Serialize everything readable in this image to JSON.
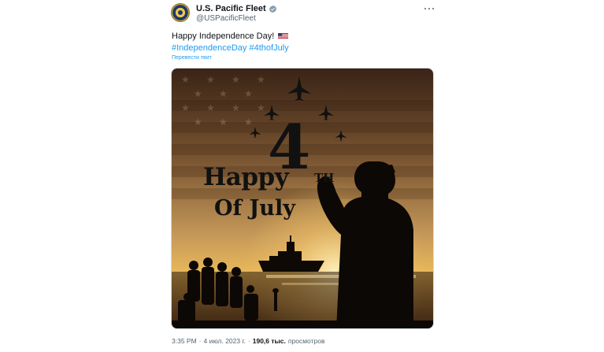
{
  "account": {
    "display_name": "U.S. Pacific Fleet",
    "handle": "@USPacificFleet",
    "verified": true
  },
  "tweet": {
    "text": "Happy Independence Day!",
    "emoji": "flag-us-icon",
    "hashtags": [
      "#IndependenceDay",
      "#4thofJuly"
    ],
    "translate_label": "Перевести твит"
  },
  "media": {
    "headline_word": "Happy",
    "headline_number": "4",
    "headline_suffix": "TH",
    "headline_line2": "Of July"
  },
  "footer": {
    "time": "3:35 PM",
    "separator": "·",
    "date": "4 июл. 2023 г.",
    "views_count": "190,6 тыс.",
    "views_label": "просмотров"
  },
  "colors": {
    "link": "#1d9bf0",
    "secondary_text": "#536471",
    "primary_text": "#0f1419"
  }
}
